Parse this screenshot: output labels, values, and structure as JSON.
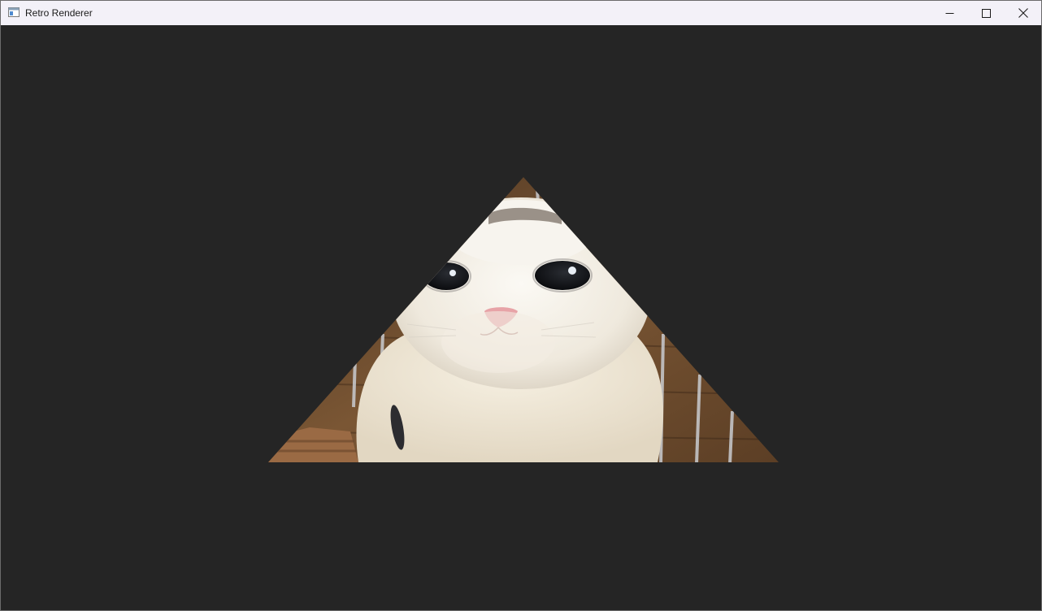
{
  "window": {
    "title": "Retro Renderer",
    "icon": "app-window-icon",
    "controls": {
      "minimize_icon": "minimize-icon",
      "maximize_icon": "maximize-icon",
      "close_icon": "close-icon"
    }
  },
  "viewport": {
    "background_color": "#252525",
    "content": "textured-triangle-cat"
  },
  "colors": {
    "titlebar": "#f3f1f8",
    "viewport_bg": "#252525",
    "fur": "#f3efe6",
    "cage_wood": "#6a4a2c"
  }
}
